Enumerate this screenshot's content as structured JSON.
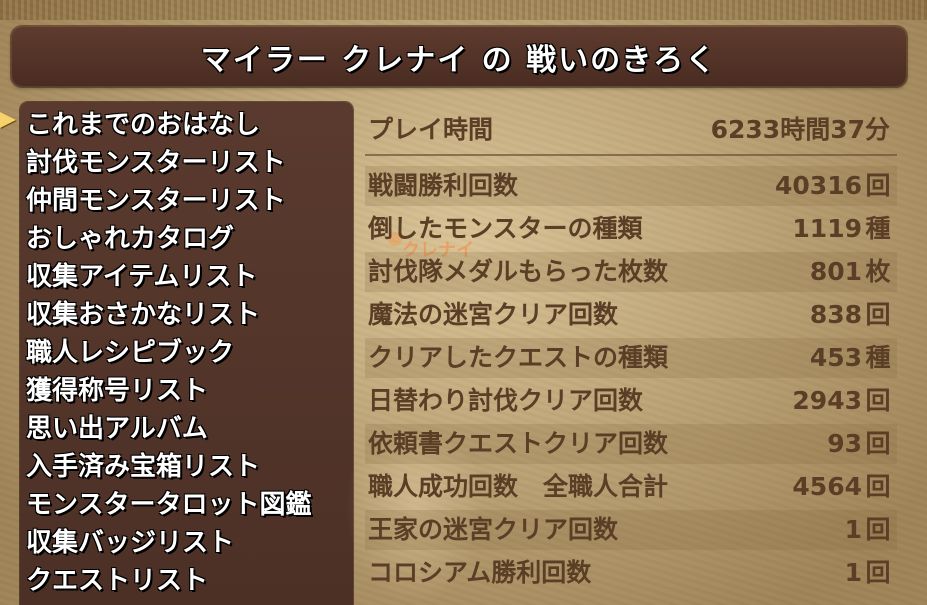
{
  "title": "マイラー クレナイ の 戦いのきろく",
  "menu": {
    "items": [
      "これまでのおはなし",
      "討伐モンスターリスト",
      "仲間モンスターリスト",
      "おしゃれカタログ",
      "収集アイテムリスト",
      "収集おさかなリスト",
      "職人レシピブック",
      "獲得称号リスト",
      "思い出アルバム",
      "入手済み宝箱リスト",
      "モンスタータロット図鑑",
      "収集バッジリスト",
      "クエストリスト"
    ],
    "selected_index": 0
  },
  "playtime": {
    "label": "プレイ時間",
    "value": "6233時間37分"
  },
  "stats": [
    {
      "label": "戦闘勝利回数",
      "value": "40316",
      "unit": "回"
    },
    {
      "label": "倒したモンスターの種類",
      "value": "1119",
      "unit": "種"
    },
    {
      "label": "討伐隊メダルもらった枚数",
      "value": "801",
      "unit": "枚"
    },
    {
      "label": "魔法の迷宮クリア回数",
      "value": "838",
      "unit": "回"
    },
    {
      "label": "クリアしたクエストの種類",
      "value": "453",
      "unit": "種"
    },
    {
      "label": "日替わり討伐クリア回数",
      "value": "2943",
      "unit": "回"
    },
    {
      "label": "依頼書クエストクリア回数",
      "value": "93",
      "unit": "回"
    },
    {
      "label": "職人成功回数　全職人合計",
      "value": "4564",
      "unit": "回"
    },
    {
      "label": "王家の迷宮クリア回数",
      "value": "1",
      "unit": "回"
    },
    {
      "label": "コロシアム勝利回数",
      "value": "1",
      "unit": "回"
    }
  ],
  "watermark": "クレナイ",
  "colors": {
    "panel": "#4c3026",
    "paper": "#c4ab7c",
    "stat_text": "#5a3e26",
    "cursor": "#f5d36a"
  }
}
